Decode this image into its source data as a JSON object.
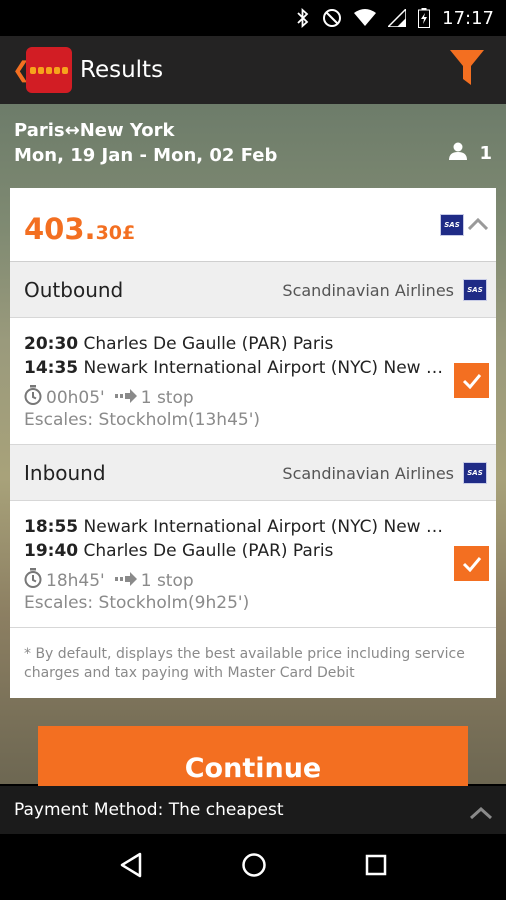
{
  "status": {
    "time": "17:17"
  },
  "app_bar": {
    "back": "❮",
    "title": "Results"
  },
  "trip": {
    "from": "Paris",
    "arrow": "↔",
    "to": "New York",
    "dates": "Mon, 19 Jan - Mon, 02 Feb",
    "passengers": "1"
  },
  "offer": {
    "price_main": "403.",
    "price_decimal": "30£",
    "airline_logo": "SAS",
    "outbound": {
      "title": "Outbound",
      "airline": "Scandinavian Airlines",
      "depart_time": "20:30",
      "depart_place": "Charles De Gaulle (PAR) Paris",
      "arrive_time": "14:35",
      "arrive_place": "Newark International Airport (NYC) New York",
      "duration": "00h05'",
      "stops": "1 stop",
      "escales": "Escales: Stockholm(13h45')",
      "selected": true
    },
    "inbound": {
      "title": "Inbound",
      "airline": "Scandinavian Airlines",
      "depart_time": "18:55",
      "depart_place": "Newark International Airport (NYC) New York",
      "arrive_time": "19:40",
      "arrive_place": "Charles De Gaulle (PAR) Paris",
      "duration": "18h45'",
      "stops": "1 stop",
      "escales": "Escales: Stockholm(9h25')",
      "selected": true
    },
    "note": "* By default,  displays the best available price including service charges and tax paying with Master Card Debit"
  },
  "continue_label": "Continue",
  "payment": {
    "label": "Payment Method: The cheapest"
  },
  "colors": {
    "accent": "#f36f21",
    "brand_red": "#d21d24",
    "sas_blue": "#1f2b86"
  },
  "icons": [
    "bluetooth-icon",
    "do-not-disturb-icon",
    "wifi-icon",
    "signal-icon",
    "battery-icon",
    "filter-icon",
    "person-icon",
    "stopwatch-icon",
    "stop-arrow-icon",
    "checkbox-icon",
    "back-nav-icon",
    "home-nav-icon",
    "recents-nav-icon"
  ]
}
